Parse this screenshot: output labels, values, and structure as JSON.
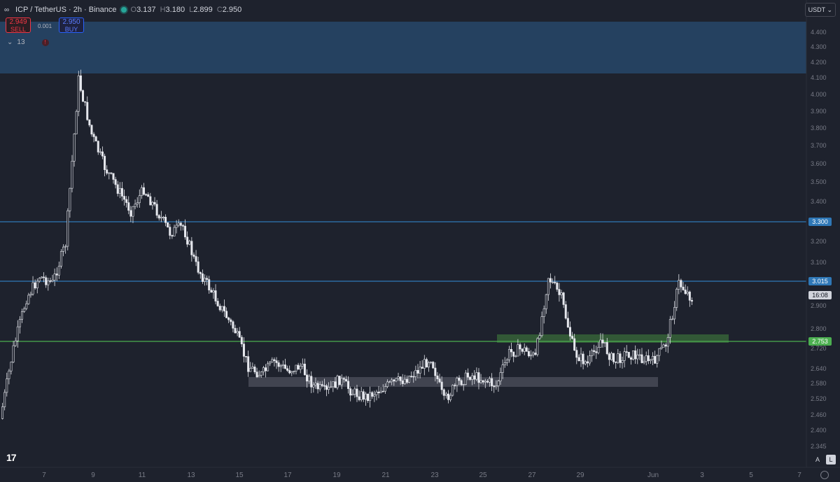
{
  "header": {
    "title": "ICP / TetherUS · 2h · Binance",
    "ohlc": [
      {
        "key": "O",
        "value": "3.137"
      },
      {
        "key": "H",
        "value": "3.180"
      },
      {
        "key": "L",
        "value": "2.899"
      },
      {
        "key": "C",
        "value": "2.950"
      }
    ]
  },
  "trade": {
    "sell_price": "2.949",
    "sell_label": "SELL",
    "spread": "0.001",
    "buy_price": "2.950",
    "buy_label": "BUY"
  },
  "indicators": {
    "count": "13"
  },
  "currency": "USDT",
  "tv_logo": "17",
  "scale_buttons": {
    "auto": "A",
    "log": "L"
  },
  "price_labels": {
    "level_high": "3.300",
    "level_mid": "3.015",
    "countdown": "16:08",
    "level_low": "2.753"
  },
  "colors": {
    "background": "#1e222d",
    "blue_line": "#2f78b7",
    "green_line": "#4caf50",
    "zone_blue": "#27476a",
    "zone_green": "#3a6b3a",
    "zone_grey": "#4a4e59",
    "candle": "#e6e8ee"
  },
  "chart_data": {
    "type": "candlestick",
    "symbol": "ICP / TetherUS",
    "interval": "2h",
    "y_ticks": [
      "4.400",
      "4.300",
      "4.200",
      "4.100",
      "4.000",
      "3.900",
      "3.800",
      "3.700",
      "3.600",
      "3.500",
      "3.400",
      "3.300",
      "3.200",
      "3.100",
      "3.015",
      "2.900",
      "2.800",
      "2.720",
      "2.640",
      "2.580",
      "2.520",
      "2.460",
      "2.400",
      "2.345"
    ],
    "x_ticks": [
      "7",
      "9",
      "11",
      "13",
      "15",
      "17",
      "19",
      "21",
      "23",
      "25",
      "27",
      "29",
      "Jun",
      "3",
      "5",
      "7"
    ],
    "horizontal_levels": [
      3.3,
      3.015,
      2.753
    ],
    "zones": [
      {
        "name": "blue-resistance-zone",
        "y_top": 4.46,
        "y_bottom": 4.14
      },
      {
        "name": "green-zone",
        "y_top": 2.79,
        "y_bottom": 2.745
      },
      {
        "name": "grey-support-zone",
        "y_top": 2.615,
        "y_bottom": 2.57
      }
    ],
    "close_path": [
      {
        "x": "6",
        "y": 2.4
      },
      {
        "x": "6.5",
        "y": 2.72
      },
      {
        "x": "7",
        "y": 2.95
      },
      {
        "x": "7.5",
        "y": 3.05
      },
      {
        "x": "8",
        "y": 3.02
      },
      {
        "x": "8.5",
        "y": 3.2
      },
      {
        "x": "9",
        "y": 3.95
      },
      {
        "x": "9.5",
        "y": 3.7
      },
      {
        "x": "10",
        "y": 3.55
      },
      {
        "x": "10.5",
        "y": 3.45
      },
      {
        "x": "11",
        "y": 3.35
      },
      {
        "x": "11.5",
        "y": 3.45
      },
      {
        "x": "12",
        "y": 3.35
      },
      {
        "x": "12.5",
        "y": 3.25
      },
      {
        "x": "13",
        "y": 3.28
      },
      {
        "x": "13.5",
        "y": 3.1
      },
      {
        "x": "14",
        "y": 3.0
      },
      {
        "x": "14.5",
        "y": 2.9
      },
      {
        "x": "15",
        "y": 2.8
      },
      {
        "x": "15.5",
        "y": 2.64
      },
      {
        "x": "16",
        "y": 2.6
      },
      {
        "x": "16.5",
        "y": 2.66
      },
      {
        "x": "17",
        "y": 2.62
      },
      {
        "x": "17.5",
        "y": 2.64
      },
      {
        "x": "18",
        "y": 2.55
      },
      {
        "x": "18.5",
        "y": 2.52
      },
      {
        "x": "19",
        "y": 2.58
      },
      {
        "x": "19.5",
        "y": 2.52
      },
      {
        "x": "20",
        "y": 2.5
      },
      {
        "x": "20.5",
        "y": 2.53
      },
      {
        "x": "21",
        "y": 2.56
      },
      {
        "x": "21.5",
        "y": 2.58
      },
      {
        "x": "22",
        "y": 2.62
      },
      {
        "x": "22.5",
        "y": 2.68
      },
      {
        "x": "23",
        "y": 2.48
      },
      {
        "x": "23.5",
        "y": 2.56
      },
      {
        "x": "24",
        "y": 2.6
      },
      {
        "x": "24.5",
        "y": 2.58
      },
      {
        "x": "25",
        "y": 2.55
      },
      {
        "x": "25.5",
        "y": 2.7
      },
      {
        "x": "26",
        "y": 2.72
      },
      {
        "x": "26.5",
        "y": 2.68
      },
      {
        "x": "27",
        "y": 3.05
      },
      {
        "x": "27.5",
        "y": 2.95
      },
      {
        "x": "28",
        "y": 2.7
      },
      {
        "x": "28.5",
        "y": 2.65
      },
      {
        "x": "29",
        "y": 2.76
      },
      {
        "x": "29.5",
        "y": 2.66
      },
      {
        "x": "30",
        "y": 2.7
      },
      {
        "x": "30.5",
        "y": 2.68
      },
      {
        "x": "31",
        "y": 2.66
      },
      {
        "x": "Jun",
        "y": 2.74
      },
      {
        "x": "1.5",
        "y": 3.02
      },
      {
        "x": "2",
        "y": 2.95
      }
    ]
  }
}
